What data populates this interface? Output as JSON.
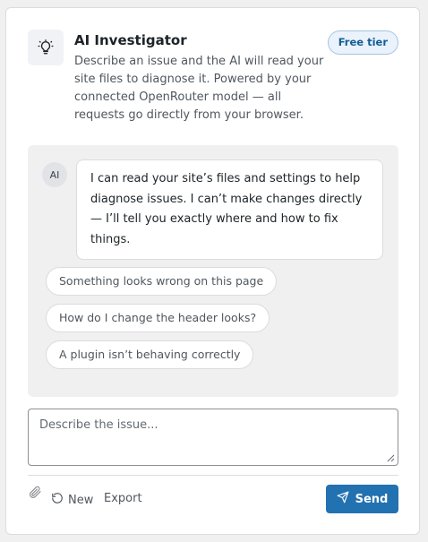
{
  "header": {
    "icon": "lightbulb-icon",
    "title": "AI Investigator",
    "description": "Describe an issue and the AI will read your site files to diagnose it. Powered by your connected OpenRouter model — all requests go directly from your browser.",
    "badge": "Free tier"
  },
  "chat": {
    "avatar_label": "AI",
    "message": "I can read your site’s files and settings to help diagnose issues. I can’t make changes directly — I’ll tell you exactly where and how to fix things.",
    "suggestions": [
      "Something looks wrong on this page",
      "How do I change the header looks?",
      "A plugin isn’t behaving correctly"
    ]
  },
  "input": {
    "placeholder": "Describe the issue...",
    "value": ""
  },
  "footer": {
    "attach_icon": "paperclip-icon",
    "new_label": "New",
    "export_label": "Export",
    "send_label": "Send"
  },
  "colors": {
    "accent": "#2271b1",
    "badge_text": "#135e96",
    "badge_bg": "#eaf2fb"
  }
}
